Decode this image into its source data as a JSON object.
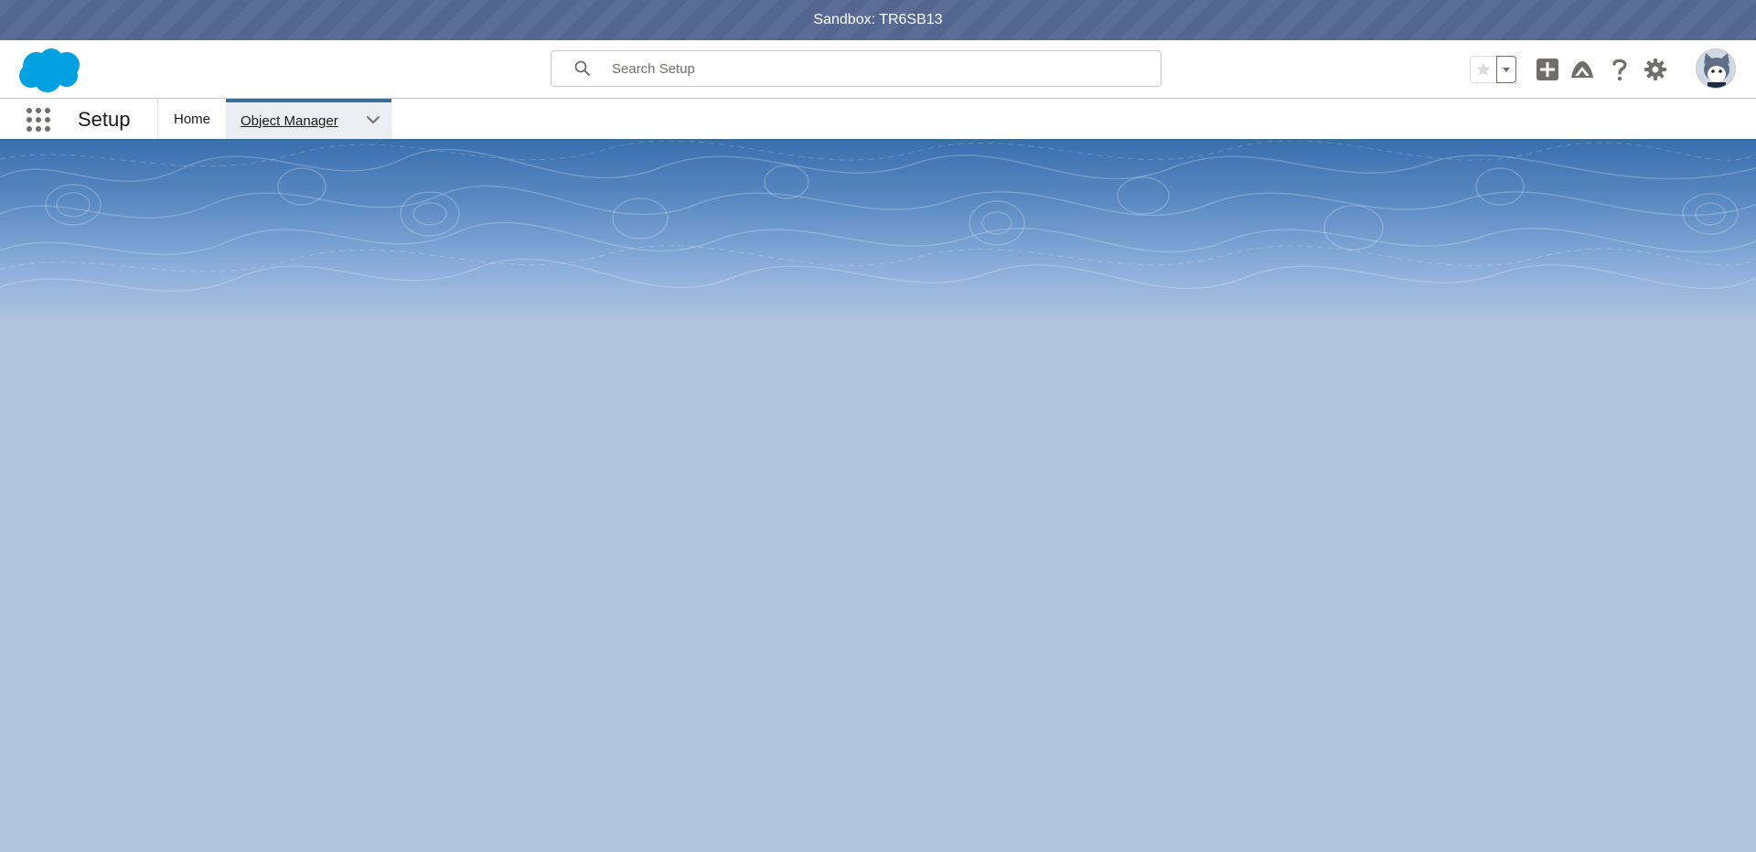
{
  "sandbox_bar": {
    "text": "Sandbox: TR6SB13"
  },
  "header": {
    "search": {
      "placeholder": "Search Setup",
      "value": ""
    },
    "icons": [
      "favorites-star-icon",
      "favorites-dropdown-icon",
      "global-actions-icon",
      "trailhead-icon",
      "help-icon",
      "setup-gear-icon",
      "avatar"
    ]
  },
  "nav": {
    "app_name": "Setup",
    "tabs": [
      {
        "label": "Home",
        "active": false
      },
      {
        "label": "Object Manager",
        "active": true
      }
    ]
  },
  "colors": {
    "sandbox_bar": "#566a93",
    "nav_active_border": "#3b6e95",
    "brand_blue": "#00a1e0",
    "background": "#b0c4df"
  }
}
